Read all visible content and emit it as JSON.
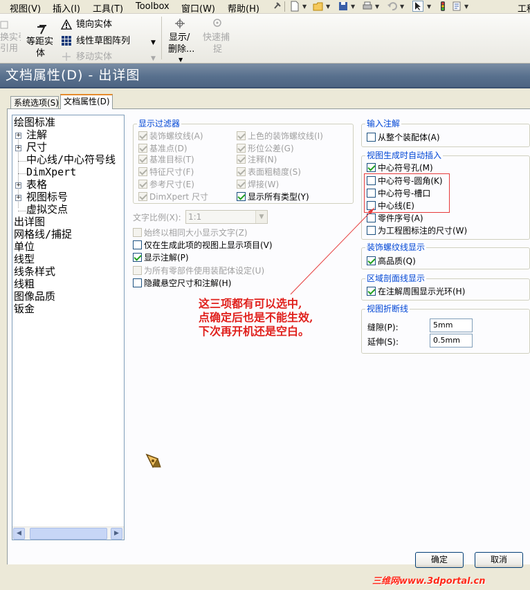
{
  "menu": {
    "items": [
      "视图(V)",
      "插入(I)",
      "工具(T)",
      "Toolbox",
      "窗口(W)",
      "帮助(H)"
    ],
    "right_text": "工程"
  },
  "commands": {
    "cut_ref": "换实引用",
    "cut_ref_line2": "引用",
    "offset": "等距实",
    "offset_line2": "体",
    "mirror": "镜向实体",
    "linear_pattern": "线性草图阵列",
    "move": "移动实体",
    "display_delete": "显示/",
    "display_delete_line2": "删除...",
    "quick_snap": "快速捕",
    "quick_snap_line2": "捉"
  },
  "dialog": {
    "title": "文档属性(D) - 出详图",
    "tabs": [
      "系统选项(S)",
      "文档属性(D)"
    ]
  },
  "tree": {
    "items": [
      "绘图标准",
      "注解",
      "尺寸",
      "中心线/中心符号线",
      "DimXpert",
      "表格",
      "视图标号",
      "虚拟交点",
      "出详图",
      "网格线/捕捉",
      "单位",
      "线型",
      "线条样式",
      "线粗",
      "图像品质",
      "钣金"
    ],
    "expanders": [
      "+",
      "+",
      "+",
      "+"
    ]
  },
  "display_filter": {
    "label": "显示过滤器",
    "left": [
      "装饰螺纹线(A)",
      "基准点(D)",
      "基准目标(T)",
      "特征尺寸(F)",
      "参考尺寸(E)",
      "DimXpert 尺寸"
    ],
    "right": [
      "上色的装饰螺纹线(I)",
      "形位公差(G)",
      "注释(N)",
      "表面粗糙度(S)",
      "焊接(W)",
      "显示所有类型(Y)"
    ]
  },
  "text_scale": {
    "label": "文字比例(X):",
    "value": "1:1"
  },
  "options": [
    "始终以相同大小显示文字(Z)",
    "仅在生成此项的视图上显示项目(V)",
    "显示注解(P)",
    "为所有零部件使用装配体设定(U)",
    "隐藏悬空尺寸和注解(H)"
  ],
  "input_annot": {
    "label": "输入注解",
    "from_assembly": "从整个装配体(A)"
  },
  "auto_insert": {
    "label": "视图生成时自动插入",
    "items": [
      "中心符号孔(M)",
      "中心符号-圆角(K)",
      "中心符号-槽口",
      "中心线(E)",
      "零件序号(A)",
      "为工程图标注的尺寸(W)"
    ]
  },
  "cosmetic": {
    "label": "装饰螺纹线显示",
    "high_quality": "高品质(Q)"
  },
  "area_hatch": {
    "label": "区域剖面线显示",
    "halo": "在注解周围显示光环(H)"
  },
  "break_line": {
    "label": "视图折断线",
    "gap_label": "缝隙(P):",
    "gap_value": "5mm",
    "ext_label": "延伸(S):",
    "ext_value": "0.5mm"
  },
  "annotation": [
    "这三项都有可以选中,",
    "点确定后也是不能生效,",
    "下次再开机还是空白。"
  ],
  "buttons": {
    "ok": "确定",
    "cancel": "取消"
  },
  "watermark": "三维网www.3dportal.cn",
  "colors": {
    "title_bar": "#58708d",
    "group_label": "#0046d5",
    "annotation": "#e0201c"
  }
}
